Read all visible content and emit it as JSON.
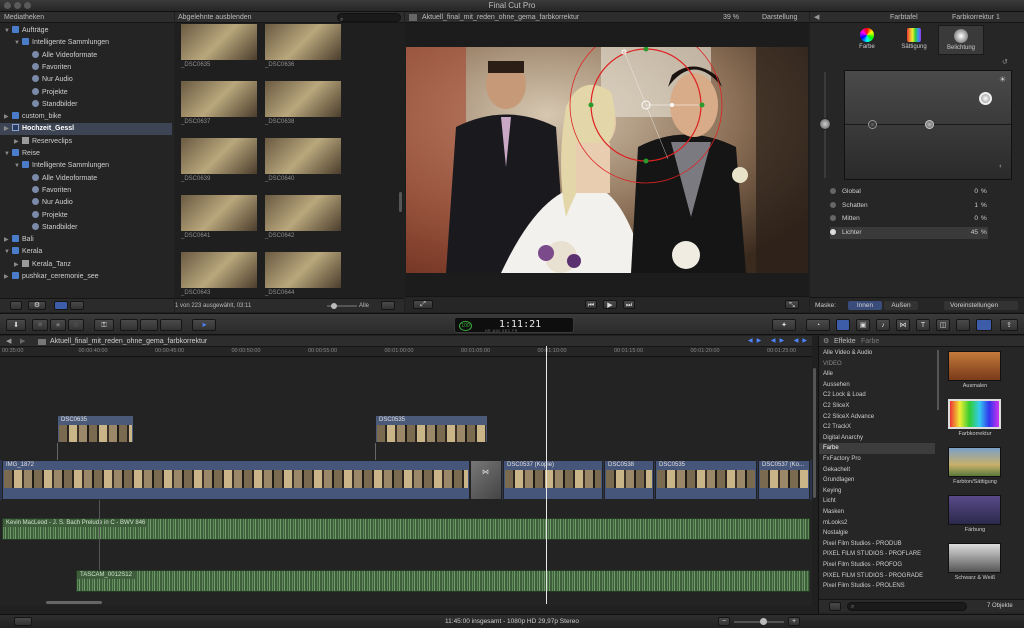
{
  "window": {
    "title": "Final Cut Pro"
  },
  "library": {
    "header": "Mediatheken",
    "rows": [
      {
        "label": "Aufträge",
        "indent": 0,
        "icon": "event-icon",
        "open": true
      },
      {
        "label": "Intelligente Sammlungen",
        "indent": 1,
        "icon": "folder-icon",
        "open": true
      },
      {
        "label": "Alle Videoformate",
        "indent": 2,
        "icon": "smart-collection-icon"
      },
      {
        "label": "Favoriten",
        "indent": 2,
        "icon": "smart-collection-icon"
      },
      {
        "label": "Nur Audio",
        "indent": 2,
        "icon": "smart-collection-icon"
      },
      {
        "label": "Projekte",
        "indent": 2,
        "icon": "smart-collection-icon"
      },
      {
        "label": "Standbilder",
        "indent": 2,
        "icon": "smart-collection-icon"
      },
      {
        "label": "custom_bike",
        "indent": 0,
        "icon": "event-icon"
      },
      {
        "label": "Hochzeit_Gessl",
        "indent": 0,
        "icon": "star-event-icon",
        "selected": true
      },
      {
        "label": "Reserveclips",
        "indent": 1,
        "icon": "keyword-icon"
      },
      {
        "label": "Reise",
        "indent": 0,
        "icon": "event-icon",
        "open": true
      },
      {
        "label": "Intelligente Sammlungen",
        "indent": 1,
        "icon": "folder-icon",
        "open": true
      },
      {
        "label": "Alle Videoformate",
        "indent": 2,
        "icon": "smart-collection-icon"
      },
      {
        "label": "Favoriten",
        "indent": 2,
        "icon": "smart-collection-icon"
      },
      {
        "label": "Nur Audio",
        "indent": 2,
        "icon": "smart-collection-icon"
      },
      {
        "label": "Projekte",
        "indent": 2,
        "icon": "smart-collection-icon"
      },
      {
        "label": "Standbilder",
        "indent": 2,
        "icon": "smart-collection-icon"
      },
      {
        "label": "Bali",
        "indent": 0,
        "icon": "event-icon"
      },
      {
        "label": "Kerala",
        "indent": 0,
        "icon": "event-icon",
        "open": true
      },
      {
        "label": "Kerala_Tanz",
        "indent": 1,
        "icon": "keyword-icon"
      },
      {
        "label": "pushkar_ceremonie_see",
        "indent": 0,
        "icon": "event-icon"
      }
    ]
  },
  "browser": {
    "filter": "Abgelehnte ausblenden",
    "thumbs": [
      "_DSC0635",
      "_DSC0636",
      "_DSC0637",
      "_DSC0638",
      "_DSC0639",
      "_DSC0640",
      "_DSC0641",
      "_DSC0642",
      "_DSC0643",
      "_DSC0644"
    ],
    "status": "1 von 223 ausgewählt, 03:11",
    "zoom_label": "Alle"
  },
  "viewer": {
    "title": "Aktuell_final_mit_reden_ohne_gema_farbkorrektur",
    "zoom": "39 %",
    "display": "Darstellung"
  },
  "inspector": {
    "title": "Farbtafel",
    "correction": "Farbkorrektur 1",
    "tabs": [
      "Farbe",
      "Sättigung",
      "Belichtung"
    ],
    "rows": [
      {
        "label": "Global",
        "value": "0",
        "unit": "%"
      },
      {
        "label": "Schatten",
        "value": "1",
        "unit": "%"
      },
      {
        "label": "Mitten",
        "value": "0",
        "unit": "%"
      },
      {
        "label": "Lichter",
        "value": "45",
        "unit": "%",
        "selected": true
      }
    ],
    "mask_label": "Maske:",
    "mask_inner": "Innen",
    "mask_outer": "Außen",
    "presets": "Voreinstellungen"
  },
  "toolbar": {
    "timecode": "1:11:21",
    "tc_labels": [
      "HR",
      "MIN",
      "SEC",
      "FR"
    ],
    "tc_percent": "100"
  },
  "timeline": {
    "title": "Aktuell_final_mit_reden_ohne_gema_farbkorrektur",
    "ruler": [
      "00:35:00",
      "00:00:40:00",
      "00:00:45:00",
      "00:00:50:00",
      "00:00:55:00",
      "00:01:00:00",
      "00:01:05:00",
      "00:01:10:00",
      "00:01:15:00",
      "00:01:20:00",
      "00:01:25:00"
    ],
    "connected": [
      "DSC0635",
      "DSC0535"
    ],
    "primary": [
      "IMG_1872",
      "DSC0537 (Kopie)",
      "DSC0538",
      "DSC0535",
      "DSC0537 (Ko..."
    ],
    "audio": [
      "Kevin MacLeod - J. S. Bach Prelude in C - BWV 846",
      "TASCAM_0012S12"
    ],
    "status": "11:45:00 insgesamt - 1080p HD 29,97p Stereo"
  },
  "effects": {
    "title": "Effekte",
    "subtitle": "Farbe",
    "categories": [
      {
        "label": "Alle Video & Audio"
      },
      {
        "label": "VIDEO",
        "header": true
      },
      {
        "label": "Alle"
      },
      {
        "label": "Aussehen"
      },
      {
        "label": "C2 Lock & Load"
      },
      {
        "label": "C2 SliceX"
      },
      {
        "label": "C2 SliceX Advance"
      },
      {
        "label": "C2 TrackX"
      },
      {
        "label": "Digital Anarchy"
      },
      {
        "label": "Farbe",
        "selected": true
      },
      {
        "label": "FxFactory Pro"
      },
      {
        "label": "Gekachelt"
      },
      {
        "label": "Grundlagen"
      },
      {
        "label": "Keying"
      },
      {
        "label": "Licht"
      },
      {
        "label": "Masken"
      },
      {
        "label": "mLooks2"
      },
      {
        "label": "Nostalgie"
      },
      {
        "label": "Pixel Film Studios - PRODUB"
      },
      {
        "label": "PIXEL FILM STUDIOS - PROFLARE"
      },
      {
        "label": "Pixel Film Studios - PROFOG"
      },
      {
        "label": "PIXEL FILM STUDIOS - PROGRADE"
      },
      {
        "label": "Pixel Film Studios - PROLENS"
      }
    ],
    "tiles": [
      "Ausmalen",
      "Farbkorrektur",
      "Farbton/Sättigung",
      "Färbung",
      "Schwarz & Weiß"
    ],
    "count": "7 Objekte"
  }
}
